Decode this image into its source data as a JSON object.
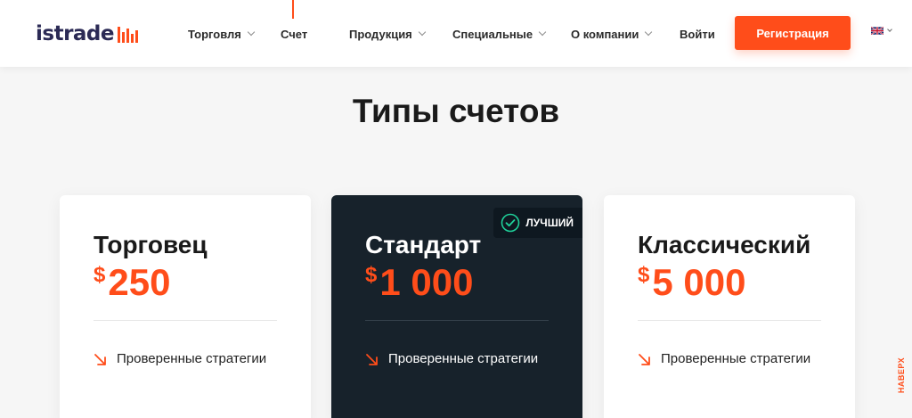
{
  "header": {
    "logo_text": "istrade",
    "nav": [
      {
        "label": "Торговля",
        "has_dropdown": true
      },
      {
        "label": "Счет",
        "has_dropdown": false,
        "active": true
      },
      {
        "label": "Продукция",
        "has_dropdown": true
      },
      {
        "label": "Специальные",
        "has_dropdown": true
      },
      {
        "label": "О компании",
        "has_dropdown": true
      }
    ],
    "login_label": "Войти",
    "register_label": "Регистрация",
    "language_icon": "uk-flag-icon"
  },
  "section": {
    "title": "Типы счетов"
  },
  "cards": [
    {
      "name": "Торговец",
      "currency": "$",
      "amount": "250",
      "features": [
        "Проверенные стратегии"
      ],
      "highlighted": false
    },
    {
      "name": "Стандарт",
      "currency": "$",
      "amount": "1 000",
      "badge": "ЛУЧШИЙ",
      "features": [
        "Проверенные стратегии"
      ],
      "highlighted": true
    },
    {
      "name": "Классический",
      "currency": "$",
      "amount": "5 000",
      "features": [
        "Проверенные стратегии"
      ],
      "highlighted": false
    }
  ],
  "back_to_top_label": "НАВЕРХ",
  "colors": {
    "accent": "#ff4d1a",
    "dark_card": "#17222b",
    "logo_text": "#2b2a55",
    "badge_check": "#1fd19a"
  }
}
